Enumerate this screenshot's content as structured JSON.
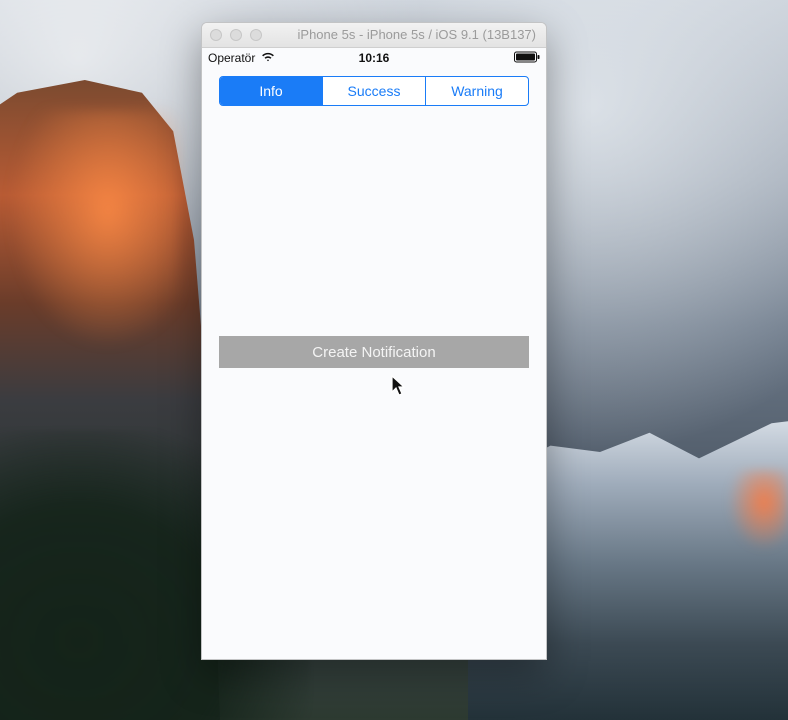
{
  "simulator": {
    "window_title": "iPhone 5s - iPhone 5s / iOS 9.1 (13B137)"
  },
  "ios_status_bar": {
    "carrier": "Operatör",
    "time": "10:16"
  },
  "segmented_control": {
    "segments": [
      {
        "label": "Info",
        "selected": true
      },
      {
        "label": "Success",
        "selected": false
      },
      {
        "label": "Warning",
        "selected": false
      }
    ],
    "accent_color": "#1a7cf7"
  },
  "main": {
    "create_notification_label": "Create Notification"
  },
  "icons": {
    "wifi": "wifi-icon",
    "battery": "battery-icon",
    "cursor": "mouse-pointer-icon"
  }
}
